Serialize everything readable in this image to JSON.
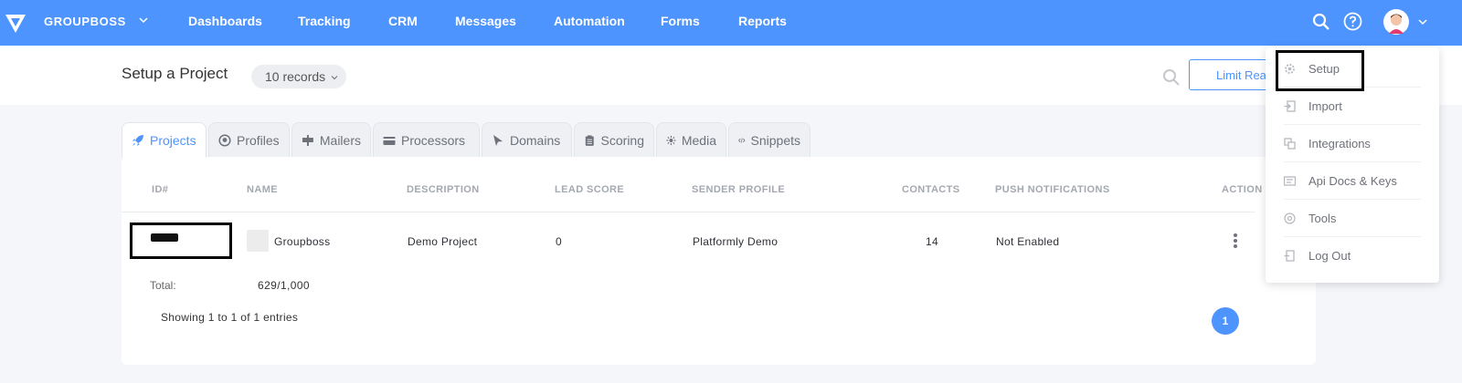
{
  "brand": {
    "name": "GROUPBOSS"
  },
  "nav": {
    "items": [
      {
        "label": "Dashboards"
      },
      {
        "label": "Tracking"
      },
      {
        "label": "CRM"
      },
      {
        "label": "Messages"
      },
      {
        "label": "Automation"
      },
      {
        "label": "Forms"
      },
      {
        "label": "Reports"
      }
    ]
  },
  "header": {
    "title": "Setup a Project",
    "records_label": "10 records",
    "limit_button": "Limit Reached"
  },
  "tabs": [
    {
      "label": "Projects",
      "icon": "rocket-icon",
      "active": true
    },
    {
      "label": "Profiles",
      "icon": "user-circle-icon"
    },
    {
      "label": "Mailers",
      "icon": "mailer-icon"
    },
    {
      "label": "Processors",
      "icon": "card-icon"
    },
    {
      "label": "Domains",
      "icon": "cursor-icon"
    },
    {
      "label": "Scoring",
      "icon": "clipboard-icon"
    },
    {
      "label": "Media",
      "icon": "media-icon"
    },
    {
      "label": "Snippets",
      "icon": "code-icon"
    }
  ],
  "table": {
    "columns": [
      "ID#",
      "NAME",
      "DESCRIPTION",
      "LEAD SCORE",
      "SENDER PROFILE",
      "CONTACTS",
      "PUSH NOTIFICATIONS",
      "ACTION"
    ],
    "rows": [
      {
        "name": "Groupboss",
        "description": "Demo Project",
        "lead_score": "0",
        "sender_profile": "Platformly Demo",
        "contacts": "14",
        "push_notifications": "Not Enabled"
      }
    ],
    "total_label": "Total:",
    "total_value": "629/1,000",
    "showing": "Showing 1 to 1 of 1 entries",
    "current_page": "1"
  },
  "dropdown": {
    "items": [
      {
        "label": "Setup",
        "icon": "gear-icon"
      },
      {
        "label": "Import",
        "icon": "import-icon"
      },
      {
        "label": "Integrations",
        "icon": "integrations-icon"
      },
      {
        "label": "Api Docs & Keys",
        "icon": "api-docs-icon"
      },
      {
        "label": "Tools",
        "icon": "tools-icon"
      },
      {
        "label": "Log Out",
        "icon": "logout-icon"
      }
    ]
  },
  "colors": {
    "primary": "#4d94ff",
    "background": "#f4f6fa",
    "header_text": "#a4a8b0"
  }
}
